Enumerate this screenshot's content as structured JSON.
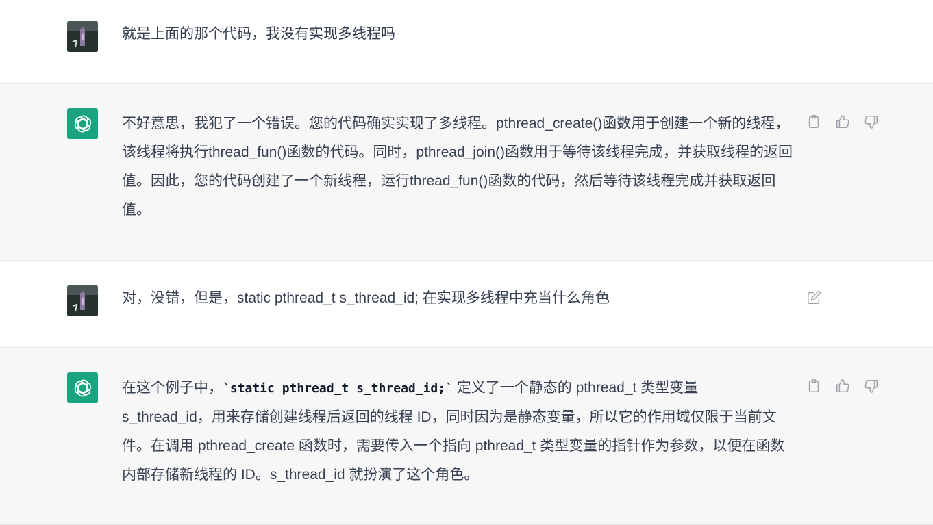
{
  "conversation": {
    "messages": [
      {
        "role": "user",
        "text": "就是上面的那个代码，我没有实现多线程吗"
      },
      {
        "role": "assistant",
        "text": "不好意思，我犯了一个错误。您的代码确实实现了多线程。pthread_create()函数用于创建一个新的线程，该线程将执行thread_fun()函数的代码。同时，pthread_join()函数用于等待该线程完成，并获取线程的返回值。因此，您的代码创建了一个新线程，运行thread_fun()函数的代码，然后等待该线程完成并获取返回值。"
      },
      {
        "role": "user",
        "text": "对，没错，但是，static pthread_t s_thread_id; 在实现多线程中充当什么角色"
      },
      {
        "role": "assistant",
        "text_before": "在这个例子中，",
        "code": "`static pthread_t s_thread_id;`",
        "text_after": " 定义了一个静态的 pthread_t 类型变量 s_thread_id，用来存储创建线程后返回的线程 ID，同时因为是静态变量，所以它的作用域仅限于当前文件。在调用 pthread_create 函数时，需要传入一个指向 pthread_t 类型变量的指针作为参数，以便在函数内部存储新线程的 ID。s_thread_id 就扮演了这个角色。"
      }
    ]
  },
  "icons": {
    "copy": "clipboard-icon",
    "thumbs_up": "thumbs-up-icon",
    "thumbs_down": "thumbs-down-icon",
    "edit": "edit-icon"
  },
  "colors": {
    "assistant_bg": "#f7f7f8",
    "assistant_avatar": "#19a37f",
    "text": "#374151",
    "icon": "#a0a0a8"
  }
}
